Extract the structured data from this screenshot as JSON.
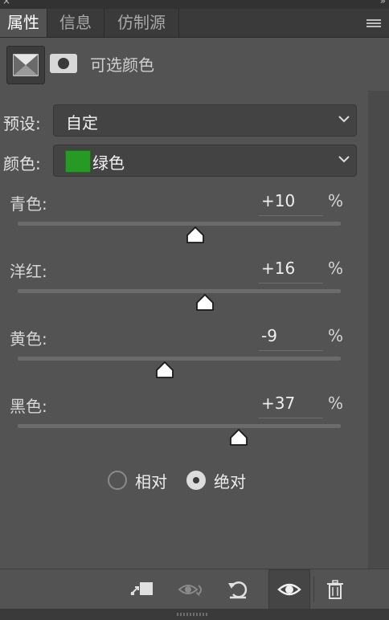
{
  "tabs": [
    {
      "label": "属性",
      "active": true
    },
    {
      "label": "信息",
      "active": false
    },
    {
      "label": "仿制源",
      "active": false
    }
  ],
  "panel_menu_icon": "hamburger-menu-icon",
  "header": {
    "mask_icon": "selective-color-adjustment-icon",
    "layer_mask_icon": "layer-mask-icon",
    "title": "可选颜色"
  },
  "preset": {
    "label": "预设:",
    "value": "自定"
  },
  "color": {
    "label": "颜色:",
    "value": "绿色",
    "swatch": "#279a25"
  },
  "sliders": [
    {
      "label": "青色:",
      "value": "+10",
      "unit": "%",
      "percent": 10
    },
    {
      "label": "洋红:",
      "value": "+16",
      "unit": "%",
      "percent": 16
    },
    {
      "label": "黄色:",
      "value": "-9",
      "unit": "%",
      "percent": -9
    },
    {
      "label": "黑色:",
      "value": "+37",
      "unit": "%",
      "percent": 37
    }
  ],
  "method": {
    "options": [
      {
        "label": "相对",
        "selected": false
      },
      {
        "label": "绝对",
        "selected": true
      }
    ]
  },
  "bottom_icons": [
    "clip-to-layer-icon",
    "view-previous-state-icon",
    "reset-icon",
    "visibility-eye-icon",
    "trash-icon"
  ],
  "colors": {
    "panel_bg": "#535353",
    "tab_bar_bg": "#3a3a3a",
    "field_bg": "#434343",
    "text": "#e3e3e3"
  }
}
